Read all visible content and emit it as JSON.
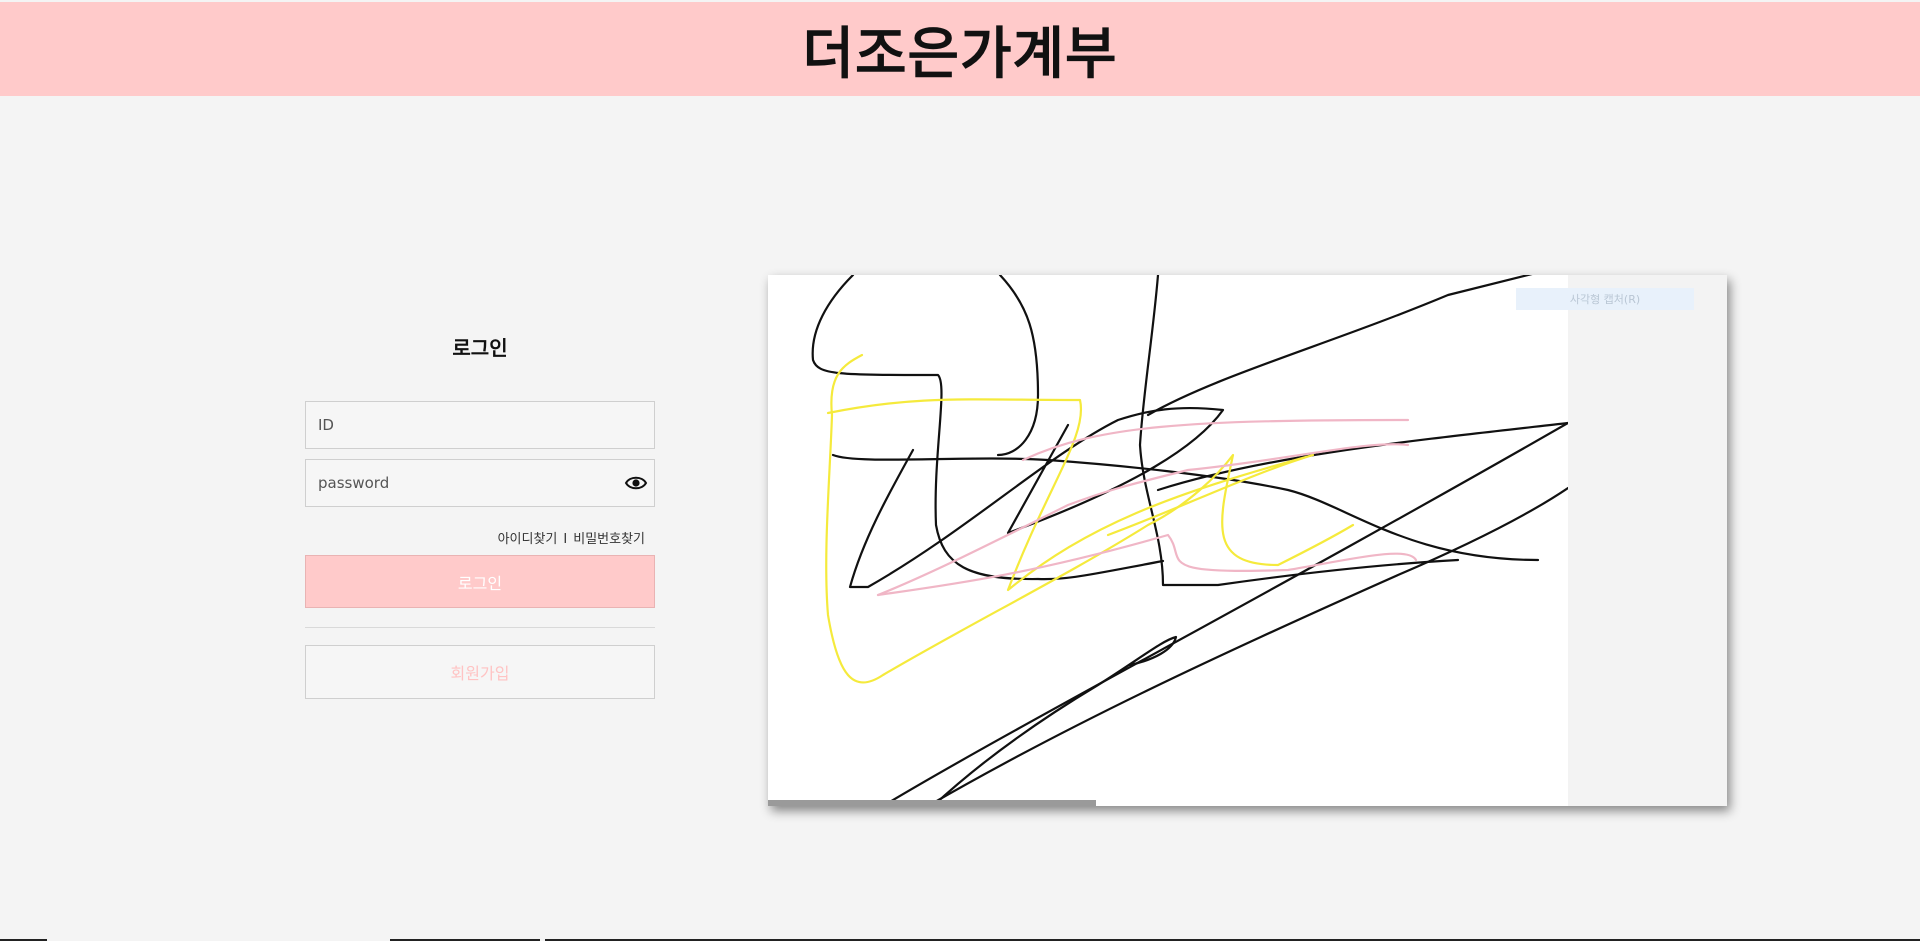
{
  "header": {
    "title": "더조은가계부",
    "background": "#ffcaca"
  },
  "login": {
    "heading": "로그인",
    "id_placeholder": "ID",
    "password_placeholder": "password",
    "find_id": "아이디찾기",
    "separator": "I",
    "find_password": "비밀번호찾기",
    "login_button": "로그인",
    "signup_button": "회원가입",
    "icons": {
      "password_toggle": "eye-icon"
    }
  },
  "canvas": {
    "capture_button": "사각형 캡처(R)",
    "stroke_colors": [
      "#111111",
      "#f5ea3c",
      "#f0b6c6"
    ]
  }
}
